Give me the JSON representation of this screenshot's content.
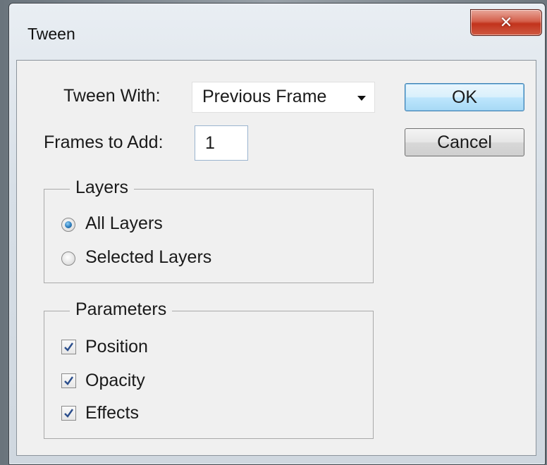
{
  "window": {
    "title": "Tween",
    "close_glyph": "✕"
  },
  "tween_with": {
    "label": "Tween With:",
    "value": "Previous Frame"
  },
  "frames_to_add": {
    "label": "Frames to Add:",
    "value": "1"
  },
  "buttons": {
    "ok": "OK",
    "cancel": "Cancel"
  },
  "layers": {
    "legend": "Layers",
    "options": [
      {
        "label": "All Layers",
        "checked": true
      },
      {
        "label": "Selected Layers",
        "checked": false
      }
    ]
  },
  "parameters": {
    "legend": "Parameters",
    "options": [
      {
        "label": "Position",
        "checked": true
      },
      {
        "label": "Opacity",
        "checked": true
      },
      {
        "label": "Effects",
        "checked": true
      }
    ]
  },
  "colors": {
    "close_button": "#c2331c",
    "default_button": "#3c7fb1",
    "check_mark": "#2b4e8c"
  }
}
